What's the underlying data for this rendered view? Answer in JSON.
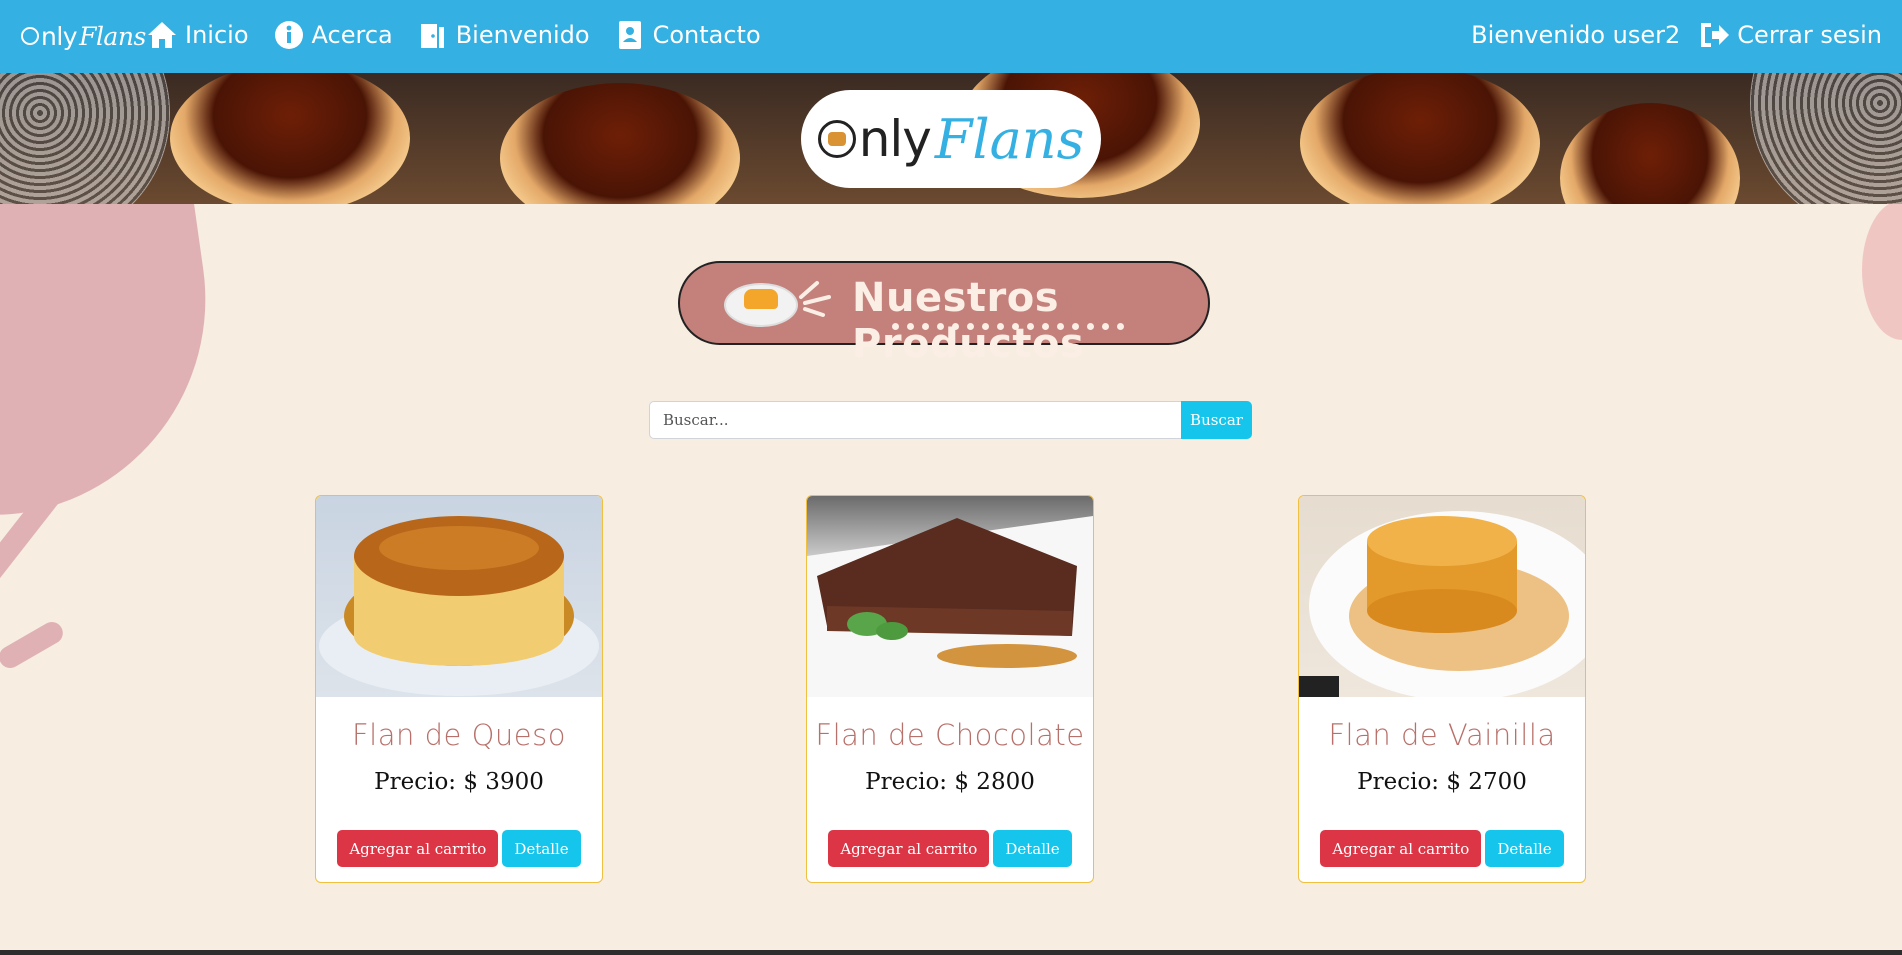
{
  "colors": {
    "navbar": "#34b0e2",
    "page_bg": "#f7ede1",
    "title_pill": "#c4817c",
    "product_name": "#b8706a",
    "btn_red": "#dc3545",
    "btn_cyan": "#16c5ec",
    "card_border": "#f0c040"
  },
  "navbar": {
    "brand_prefix": "nly",
    "brand_script": "Flans",
    "links": [
      {
        "label": "Inicio",
        "icon": "home-icon"
      },
      {
        "label": "Acerca",
        "icon": "info-icon"
      },
      {
        "label": "Bienvenido",
        "icon": "door-icon"
      },
      {
        "label": "Contacto",
        "icon": "contact-card-icon"
      }
    ],
    "welcome": "Bienvenido user2",
    "logout": {
      "label": "Cerrar sesin",
      "icon": "logout-icon"
    }
  },
  "hero": {
    "logo_only": "nly",
    "logo_script": "Flans"
  },
  "section": {
    "title": "Nuestros Productos"
  },
  "search": {
    "placeholder": "Buscar...",
    "button": "Buscar"
  },
  "products": [
    {
      "name": "Flan de Queso",
      "price": "Precio: $ 3900",
      "add": "Agregar al carrito",
      "detail": "Detalle"
    },
    {
      "name": "Flan de Chocolate",
      "price": "Precio: $ 2800",
      "add": "Agregar al carrito",
      "detail": "Detalle"
    },
    {
      "name": "Flan de Vainilla",
      "price": "Precio: $ 2700",
      "add": "Agregar al carrito",
      "detail": "Detalle"
    }
  ]
}
